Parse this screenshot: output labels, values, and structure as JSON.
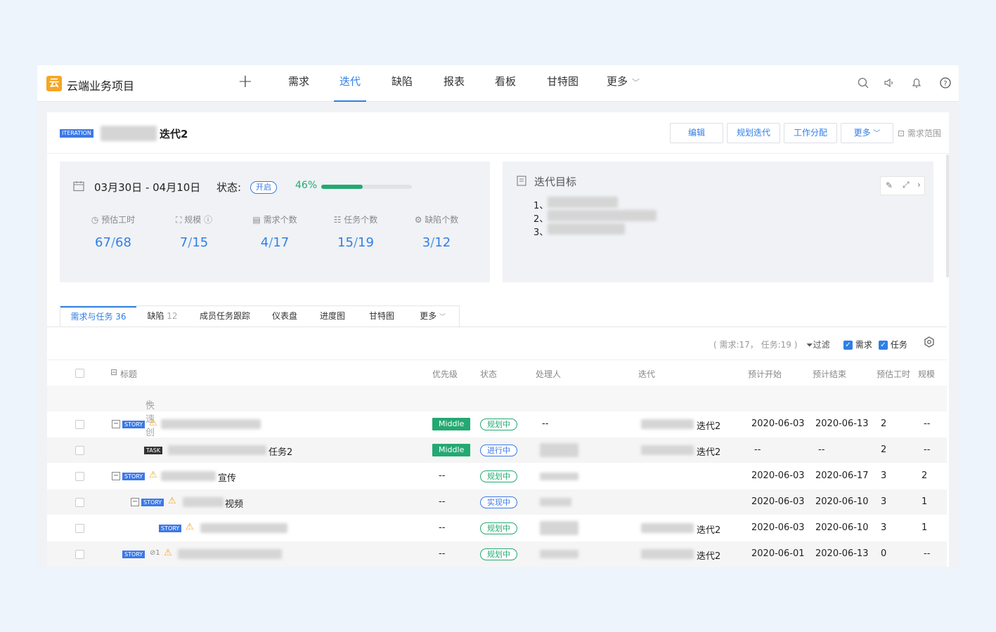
{
  "colors": {
    "accent": "#2f7fe6",
    "success": "#23a971",
    "warning": "#f5a623",
    "logo": "#f5a623"
  },
  "header": {
    "logo_glyph": "云",
    "project_name": "云端业务项目",
    "nav": [
      "需求",
      "迭代",
      "缺陷",
      "报表",
      "看板",
      "甘特图",
      "更多"
    ],
    "active_nav": "迭代"
  },
  "iteration": {
    "badge": "ITERATION",
    "title": "迭代2",
    "buttons": [
      "编辑",
      "规划迭代",
      "工作分配",
      "更多"
    ],
    "scope_label": "需求范围"
  },
  "summary": {
    "date_range": "03月30日  -  04月10日",
    "status_label": "状态:",
    "status_value": "开启",
    "progress_text": "46%",
    "progress_value": 0.46,
    "stats": [
      {
        "label": "预估工时",
        "done": "67",
        "total": "68"
      },
      {
        "label": "规模",
        "done": "7",
        "total": "15"
      },
      {
        "label": "需求个数",
        "done": "4",
        "total": "17"
      },
      {
        "label": "任务个数",
        "done": "15",
        "total": "19"
      },
      {
        "label": "缺陷个数",
        "done": "3",
        "total": "12"
      }
    ]
  },
  "goals": {
    "title": "迭代目标",
    "items": [
      "1、",
      "2、",
      "3、"
    ]
  },
  "tabs": [
    {
      "label": "需求与任务",
      "count": "36"
    },
    {
      "label": "缺陷",
      "count": "12"
    },
    {
      "label": "成员任务跟踪",
      "count": ""
    },
    {
      "label": "仪表盘",
      "count": ""
    },
    {
      "label": "进度图",
      "count": ""
    },
    {
      "label": "甘特图",
      "count": ""
    },
    {
      "label": "更多",
      "count": ""
    }
  ],
  "filter_bar": {
    "summary": "( 需求:17， 任务:19 )",
    "filter_label": "过滤",
    "req_label": "需求",
    "task_label": "任务"
  },
  "table": {
    "columns": [
      "标题",
      "优先级",
      "状态",
      "处理人",
      "迭代",
      "预计开始",
      "预计结束",
      "预估工时",
      "规模"
    ],
    "quick_create": "快速创建",
    "rows": [
      {
        "type": "STORY",
        "title_suffix": "",
        "priority": "Middle",
        "status": "规划中",
        "owner": "--",
        "iteration": "迭代2",
        "start": "2020-06-03",
        "end": "2020-06-13",
        "hours": "2",
        "scale": "--"
      },
      {
        "type": "TASK",
        "title_suffix": "任务2",
        "priority": "Middle",
        "status": "进行中",
        "owner": "",
        "iteration": "迭代2",
        "start": "--",
        "end": "--",
        "hours": "2",
        "scale": "--"
      },
      {
        "type": "STORY",
        "title_suffix": "宣传",
        "priority": "--",
        "status": "规划中",
        "owner": "",
        "iteration": "",
        "start": "2020-06-03",
        "end": "2020-06-17",
        "hours": "3",
        "scale": "2"
      },
      {
        "type": "STORY",
        "title_suffix": "视频",
        "priority": "--",
        "status": "实现中",
        "owner": "",
        "iteration": "",
        "start": "2020-06-03",
        "end": "2020-06-10",
        "hours": "3",
        "scale": "1"
      },
      {
        "type": "STORY",
        "title_suffix": "",
        "priority": "--",
        "status": "规划中",
        "owner": "",
        "iteration": "迭代2",
        "start": "2020-06-03",
        "end": "2020-06-10",
        "hours": "3",
        "scale": "1"
      },
      {
        "type": "STORY",
        "title_suffix": "",
        "link_count": "1",
        "priority": "--",
        "status": "规划中",
        "owner": "",
        "iteration": "迭代2",
        "start": "2020-06-01",
        "end": "2020-06-13",
        "hours": "0",
        "scale": "--"
      }
    ]
  }
}
